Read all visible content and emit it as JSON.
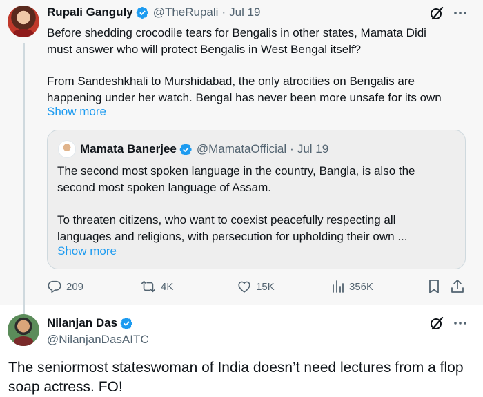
{
  "tweet1": {
    "author_name": "Rupali Ganguly",
    "author_handle": "@TheRupali",
    "separator": "·",
    "date": "Jul 19",
    "text_lines": [
      "Before shedding crocodile tears for Bengalis in other states, Mamata Didi",
      "must answer who will protect Bengalis in West Bengal itself?",
      "From Sandeshkhali to Murshidabad, the only atrocities on Bengalis are",
      "happening under her watch. Bengal has never been more unsafe for its own"
    ],
    "show_more": "Show more",
    "quote": {
      "author_name": "Mamata Banerjee",
      "author_handle": "@MamataOfficial",
      "separator": "·",
      "date": "Jul 19",
      "text_lines": [
        "The second most spoken language in the country, Bangla, is also the",
        "second most spoken language of Assam.",
        "To threaten citizens, who want to coexist peacefully respecting all",
        "languages and religions, with persecution for upholding their own ..."
      ],
      "show_more": "Show more"
    },
    "actions": {
      "replies": "209",
      "reposts": "4K",
      "likes": "15K",
      "views": "356K"
    }
  },
  "tweet2": {
    "author_name": "Nilanjan Das",
    "author_handle": "@NilanjanDasAITC",
    "text_lines": [
      "The seniormost stateswoman of India doesn’t need lectures from a flop",
      "soap actress. FO!"
    ]
  },
  "colors": {
    "verified_blue": "#1d9bf0",
    "link_blue": "#1d9bf0",
    "muted_text": "#536471"
  }
}
